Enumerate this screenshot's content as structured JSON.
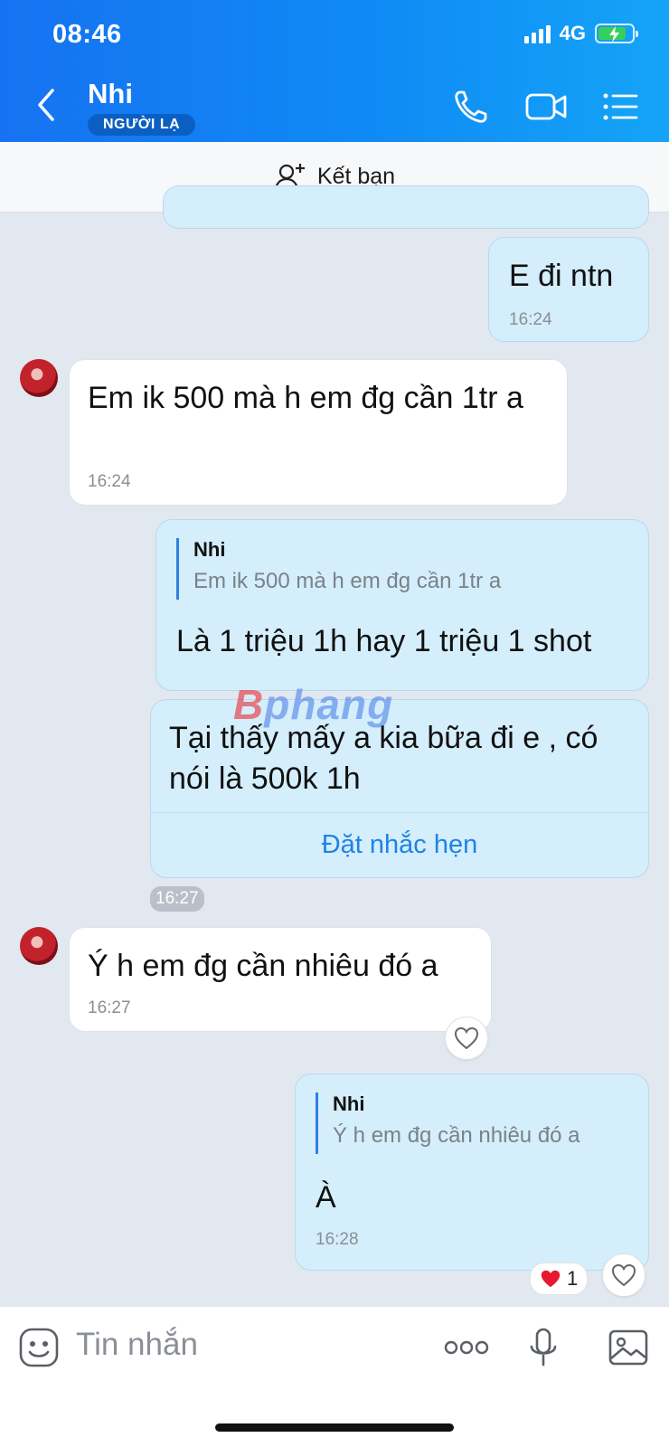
{
  "status": {
    "time": "08:46",
    "network": "4G"
  },
  "header": {
    "name": "Nhi",
    "badge": "NGƯỜI LẠ"
  },
  "add_friend": {
    "label": "Kết bạn"
  },
  "messages": {
    "m1": {
      "text": "E đi ntn",
      "time": "16:24"
    },
    "m2": {
      "text": "Em ik 500 mà h em đg cần 1tr a",
      "time": "16:24"
    },
    "m3": {
      "quote_name": "Nhi",
      "quote_text": "Em ik 500 mà h em đg cần 1tr a",
      "text": "Là 1 triệu 1h hay 1 triệu 1 shot"
    },
    "m4": {
      "text": "Tại thấy mấy a kia bữa đi e , có nói là 500k 1h",
      "reminder": "Đặt nhắc hẹn",
      "time": "16:27"
    },
    "m5": {
      "text": "Ý h em đg cần nhiêu đó a",
      "time": "16:27"
    },
    "m6": {
      "quote_name": "Nhi",
      "quote_text": "Ý h em đg cần nhiêu đó a",
      "text": "À",
      "time": "16:28",
      "reaction_count": "1"
    }
  },
  "watermark": {
    "prefix": "B",
    "rest": "phang"
  },
  "input": {
    "placeholder": "Tin nhắn"
  },
  "colors": {
    "header": "#0f8af5",
    "my_bubble": "#d4eefb",
    "accent": "#1f82e6"
  },
  "icons": [
    "back-icon",
    "phone-icon",
    "video-icon",
    "menu-icon",
    "add-friend-icon",
    "heart-icon",
    "emoji-icon",
    "more-icon",
    "mic-icon",
    "image-icon"
  ]
}
